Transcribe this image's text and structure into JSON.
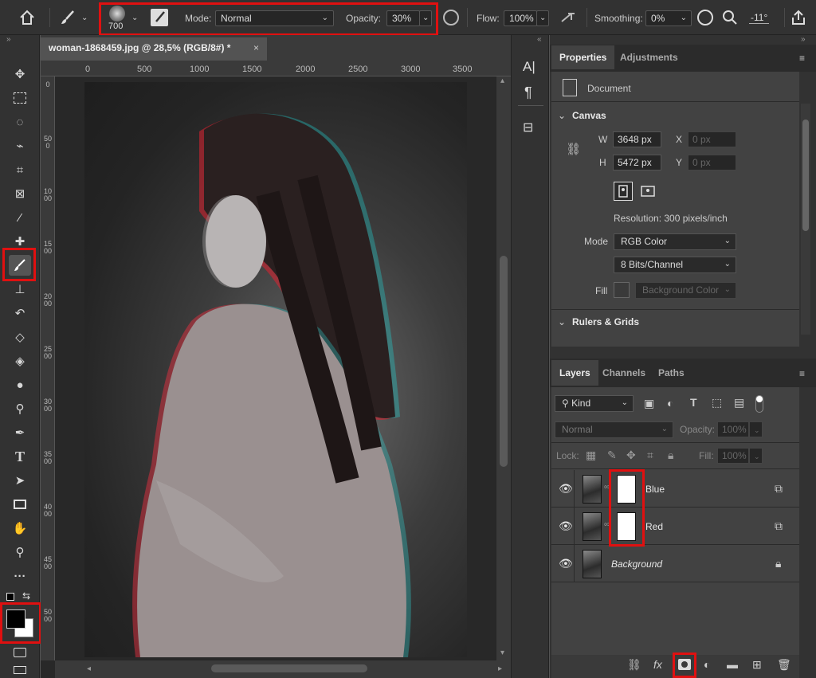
{
  "options_bar": {
    "brush_size": "700",
    "mode_label": "Mode:",
    "mode_value": "Normal",
    "opacity_label": "Opacity:",
    "opacity_value": "30%",
    "flow_label": "Flow:",
    "flow_value": "100%",
    "smoothing_label": "Smoothing:",
    "smoothing_value": "0%",
    "angle_value": "-11°"
  },
  "document": {
    "tab_title": "woman-1868459.jpg @ 28,5% (RGB/8#) *",
    "close_glyph": "×",
    "h_ruler": [
      "0",
      "500",
      "1000",
      "1500",
      "2000",
      "2500",
      "3000",
      "3500"
    ],
    "v_ruler": [
      "0",
      "500",
      "1000",
      "1500",
      "2000",
      "2500",
      "3000",
      "3500",
      "4000",
      "4500",
      "5000"
    ]
  },
  "properties": {
    "tab_properties": "Properties",
    "tab_adjustments": "Adjustments",
    "doc_label": "Document",
    "canvas_section": "Canvas",
    "w_label": "W",
    "w_value": "3648 px",
    "h_label": "H",
    "h_value": "5472 px",
    "x_label": "X",
    "x_placeholder": "0 px",
    "y_label": "Y",
    "y_placeholder": "0 px",
    "resolution": "Resolution: 300 pixels/inch",
    "mode_label": "Mode",
    "mode_value": "RGB Color",
    "bits_value": "8 Bits/Channel",
    "fill_label": "Fill",
    "fill_value": "Background Color",
    "rulers_section": "Rulers & Grids"
  },
  "layers_panel": {
    "tab_layers": "Layers",
    "tab_channels": "Channels",
    "tab_paths": "Paths",
    "kind_label": "Kind",
    "blend_mode": "Normal",
    "opacity_label": "Opacity:",
    "opacity_value": "100%",
    "lock_label": "Lock:",
    "fill_label": "Fill:",
    "fill_value": "100%",
    "layers": [
      {
        "name": "Blue"
      },
      {
        "name": "Red"
      },
      {
        "name": "Background"
      }
    ]
  },
  "colors": {
    "highlight": "#e01010",
    "foreground": "#000000",
    "background": "#ffffff"
  }
}
